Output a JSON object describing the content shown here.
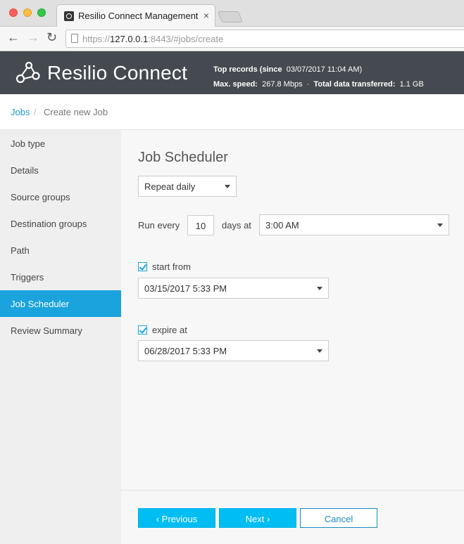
{
  "browser": {
    "tab_title": "Resilio Connect Management C",
    "tab_close": "×",
    "url_scheme": "https://",
    "url_host": "127.0.0.1",
    "url_rest": ":8443/#jobs/create",
    "back_icon": "←",
    "forward_icon": "→",
    "reload_icon": "↻"
  },
  "header": {
    "logo_text": "Resilio Connect",
    "stats_line1_label": "Top records (since",
    "stats_line1_value": "03/07/2017 11:04 AM)",
    "max_speed_label": "Max. speed:",
    "max_speed_value": "267.8 Mbps",
    "separator": "·",
    "total_label": "Total data transferred:",
    "total_value": "1.1 GB"
  },
  "breadcrumb": {
    "root": "Jobs",
    "sep": "/",
    "current": "Create new Job"
  },
  "sidebar": {
    "items": [
      {
        "label": "Job type"
      },
      {
        "label": "Details"
      },
      {
        "label": "Source groups"
      },
      {
        "label": "Destination groups"
      },
      {
        "label": "Path"
      },
      {
        "label": "Triggers"
      },
      {
        "label": "Job Scheduler",
        "active": true
      },
      {
        "label": "Review Summary"
      }
    ]
  },
  "scheduler": {
    "title": "Job Scheduler",
    "repeat_value": "Repeat daily",
    "run_every_label": "Run every",
    "run_every_value": "10",
    "days_at_label": "days at",
    "time_value": "3:00 AM",
    "start_from_label": "start from",
    "start_from_checked": true,
    "start_from_value": "03/15/2017 5:33 PM",
    "expire_at_label": "expire at",
    "expire_at_checked": true,
    "expire_at_value": "06/28/2017 5:33 PM"
  },
  "footer": {
    "previous_label": "‹ Previous",
    "next_label": "Next ›",
    "cancel_label": "Cancel"
  },
  "colors": {
    "accent": "#1aa3dc",
    "button": "#00bdf2",
    "header_bg": "#444a4f"
  }
}
